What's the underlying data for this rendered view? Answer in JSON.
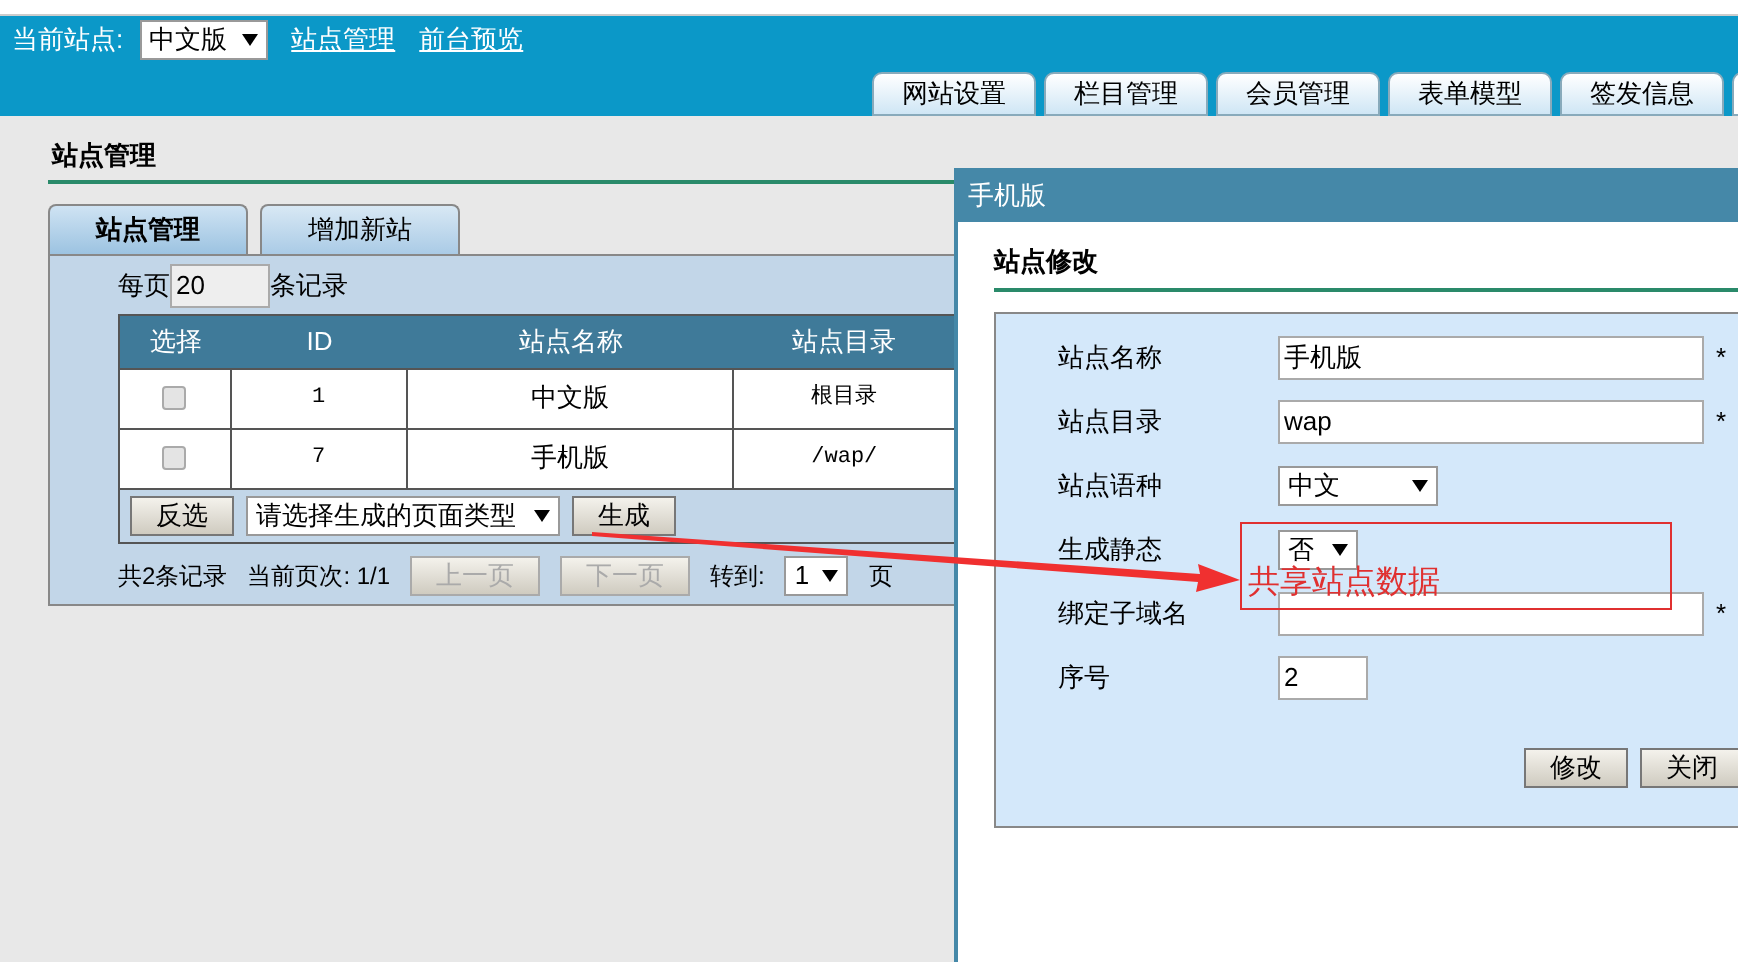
{
  "top_bar": {
    "site_label": "当前站点:",
    "site_select": "中文版",
    "links": [
      "站点管理",
      "前台预览"
    ]
  },
  "nav_tabs": [
    {
      "label": "网站设置"
    },
    {
      "label": "栏目管理"
    },
    {
      "label": "会员管理"
    },
    {
      "label": "表单模型"
    },
    {
      "label": "签发信息"
    }
  ],
  "page_title": "站点管理",
  "panel_tabs": [
    {
      "label": "站点管理",
      "selected": true
    },
    {
      "label": "增加新站",
      "selected": false
    }
  ],
  "per_page": {
    "prefix": "每页",
    "value": "20",
    "suffix": "条记录"
  },
  "table": {
    "columns": [
      "选择",
      "ID",
      "站点名称",
      "站点目录"
    ],
    "rows": [
      {
        "checked": false,
        "cells": [
          "",
          "1",
          "中文版",
          "根目录"
        ]
      },
      {
        "checked": false,
        "cells": [
          "",
          "7",
          "手机版",
          "/wap/"
        ]
      }
    ]
  },
  "actions": {
    "invert_button": "反选",
    "type_select": "请选择生成的页面类型",
    "generate_button": "生成"
  },
  "pager": {
    "total": "共2条记录",
    "current": "当前页次: 1/1",
    "prev": {
      "label": "上一页",
      "disabled": true
    },
    "next": {
      "label": "下一页",
      "disabled": true
    },
    "goto_label": "转到:",
    "goto_value": "1",
    "page_suffix": "页"
  },
  "dialog": {
    "title": "手机版",
    "heading": "站点修改",
    "fields": [
      {
        "kind": "text",
        "label": "站点名称",
        "value": "手机版",
        "note": "*"
      },
      {
        "kind": "text",
        "label": "站点目录",
        "value": "wap",
        "note": "*"
      },
      {
        "kind": "select",
        "label": "站点语种",
        "value": "中文"
      },
      {
        "kind": "select",
        "label": "生成静态",
        "value": "否"
      },
      {
        "kind": "text",
        "label": "绑定子域名",
        "note": "*"
      },
      {
        "kind": "short",
        "label": "序号",
        "value": "2"
      }
    ],
    "buttons": [
      "修改",
      "关闭"
    ]
  },
  "annotation": {
    "text": "共享站点数据"
  }
}
